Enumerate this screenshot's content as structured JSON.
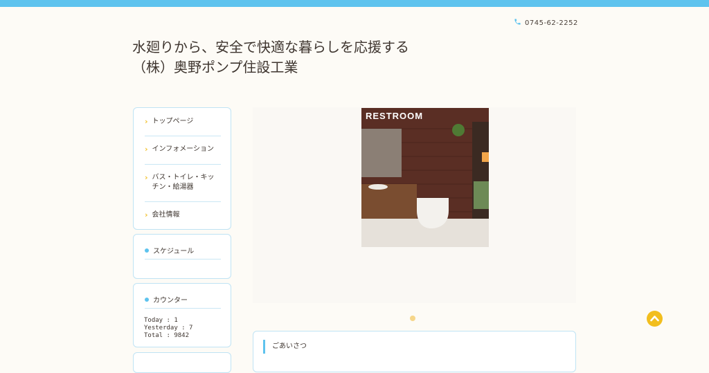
{
  "header": {
    "phone": "0745-62-2252",
    "title_line1": "水廻りから、安全で快適な暮らしを応援する",
    "title_line2": "（株）奥野ポンプ住設工業"
  },
  "nav": {
    "items": [
      {
        "label": "トップページ"
      },
      {
        "label": "インフォメーション"
      },
      {
        "label": "バス・トイレ・キッチン・給湯器"
      },
      {
        "label": "会社情報"
      }
    ]
  },
  "schedule": {
    "title": "スケジュール"
  },
  "counter": {
    "title": "カウンター",
    "today": "Today : 1",
    "yesterday": "Yesterday : 7",
    "total": "Total : 9842"
  },
  "slider": {
    "image_caption": "RESTROOM",
    "active_slide": 1
  },
  "content": {
    "greeting_title": "ごあいさつ"
  },
  "colors": {
    "accent_blue": "#5ec3ee",
    "accent_yellow": "#f2c230",
    "background": "#fdfbf6"
  },
  "icons": {
    "phone": "phone-icon",
    "nav_bullet": "chevron-right-icon",
    "widget_bullet": "dot-icon",
    "back_to_top": "chevron-up-icon"
  }
}
